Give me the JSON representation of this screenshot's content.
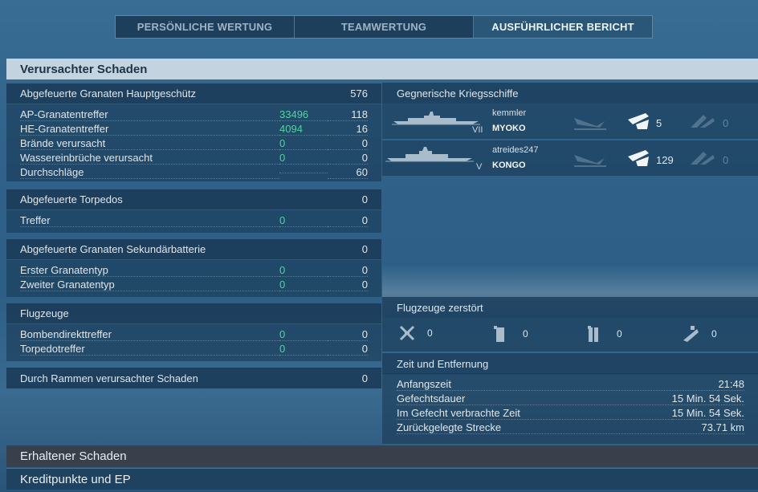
{
  "tabs": [
    "PERSÖNLICHE WERTUNG",
    "TEAMWERTUNG",
    "AUSFÜHRLICHER BERICHT"
  ],
  "section_title": "Verursachter Schaden",
  "main_battery": {
    "label": "Abgefeuerte Granaten Hauptgeschütz",
    "value": "576",
    "rows": [
      {
        "label": "AP-Granatentreffer",
        "green": "33496",
        "value": "118"
      },
      {
        "label": "HE-Granatentreffer",
        "green": "4094",
        "value": "16"
      },
      {
        "label": "Brände verursacht",
        "green": "0",
        "value": "0"
      },
      {
        "label": "Wassereinbrüche verursacht",
        "green": "0",
        "value": "0"
      },
      {
        "label": "Durchschläge",
        "green": "",
        "value": "60"
      }
    ]
  },
  "torpedoes": {
    "label": "Abgefeuerte Torpedos",
    "value": "0",
    "rows": [
      {
        "label": "Treffer",
        "green": "0",
        "value": "0"
      }
    ]
  },
  "secondary": {
    "label": "Abgefeuerte Granaten Sekundärbatterie",
    "value": "0",
    "rows": [
      {
        "label": "Erster Granatentyp",
        "green": "0",
        "value": "0"
      },
      {
        "label": "Zweiter Granatentyp",
        "green": "0",
        "value": "0"
      }
    ]
  },
  "aircraft": {
    "label": "Flugzeuge",
    "rows": [
      {
        "label": "Bombendirekttreffer",
        "green": "0",
        "value": "0"
      },
      {
        "label": "Torpedotreffer",
        "green": "0",
        "value": "0"
      }
    ]
  },
  "ramming": {
    "label": "Durch Rammen verursachter Schaden",
    "value": "0"
  },
  "enemy_ships": {
    "label": "Gegnerische Kriegsschiffe",
    "ships": [
      {
        "player": "kemmler",
        "tier": "VII",
        "name": "MYOKO",
        "count_a": "5",
        "count_b": "0"
      },
      {
        "player": "atreides247",
        "tier": "V",
        "name": "KONGO",
        "count_a": "129",
        "count_b": "0"
      }
    ]
  },
  "planes_destroyed": {
    "label": "Flugzeuge zerstört",
    "items": [
      {
        "icon": "fighter-icon",
        "count": "0"
      },
      {
        "icon": "bomber-icon",
        "count": "0"
      },
      {
        "icon": "torpedo-bomber-icon",
        "count": "0"
      },
      {
        "icon": "dive-bomber-icon",
        "count": "0"
      }
    ]
  },
  "time_distance": {
    "label": "Zeit und Entfernung",
    "rows": [
      {
        "label": "Anfangszeit",
        "value": "21:48"
      },
      {
        "label": "Gefechtsdauer",
        "value": "15 Min. 54 Sek."
      },
      {
        "label": "Im Gefecht verbrachte Zeit",
        "value": "15 Min. 54 Sek."
      },
      {
        "label": "Zurückgelegte Strecke",
        "value": "73.71 km"
      }
    ]
  },
  "bottom": {
    "received": "Erhaltener Schaden",
    "credits": "Kreditpunkte und EP"
  }
}
